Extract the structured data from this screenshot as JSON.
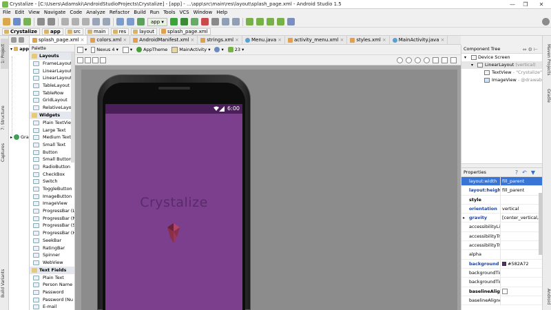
{
  "window": {
    "title": "Crystalize - [C:\\Users\\Adamski\\AndroidStudioProjects\\Crystalize] - [app] - ...\\app\\src\\main\\res\\layout\\splash_page.xml - Android Studio 1.5",
    "minimize": "—",
    "maximize": "❐",
    "close": "✕"
  },
  "menu": [
    "File",
    "Edit",
    "View",
    "Navigate",
    "Code",
    "Analyze",
    "Refactor",
    "Build",
    "Run",
    "Tools",
    "VCS",
    "Window",
    "Help"
  ],
  "toolbar": {
    "run_config": "app ▾"
  },
  "breadcrumbs": [
    "Crystalize",
    "app",
    "src",
    "main",
    "res",
    "layout",
    "splash_page.xml"
  ],
  "left_tabs": {
    "project": "1: Project",
    "structure": "7: Structure",
    "captures": "Captures",
    "build_variants": "Build Variants"
  },
  "project_tree": {
    "root": "app",
    "gradle": "Gra"
  },
  "editor_tabs": [
    {
      "label": "splash_page.xml",
      "color": "#e0a050",
      "active": true
    },
    {
      "label": "colors.xml",
      "color": "#e0a050",
      "active": false
    },
    {
      "label": "AndroidManifest.xml",
      "color": "#e0a050",
      "active": false
    },
    {
      "label": "strings.xml",
      "color": "#e0a050",
      "active": false
    },
    {
      "label": "Menu.java",
      "color": "#5aa0d0",
      "active": false
    },
    {
      "label": "activity_menu.xml",
      "color": "#e0a050",
      "active": false
    },
    {
      "label": "styles.xml",
      "color": "#e0a050",
      "active": false
    },
    {
      "label": "MainActivity.java",
      "color": "#5aa0d0",
      "active": false
    }
  ],
  "palette": {
    "header": "Palette",
    "categories": [
      {
        "name": "Layouts",
        "items": [
          "FrameLayout",
          "LinearLayout (H",
          "LinearLayout (V",
          "TableLayout",
          "TableRow",
          "GridLayout",
          "RelativeLayout"
        ]
      },
      {
        "name": "Widgets",
        "items": [
          "Plain TextView",
          "Large Text",
          "Medium Text",
          "Small Text",
          "Button",
          "Small Button",
          "RadioButton",
          "CheckBox",
          "Switch",
          "ToggleButton",
          "ImageButton",
          "ImageView",
          "ProgressBar (L",
          "ProgressBar (N",
          "ProgressBar (S",
          "ProgressBar (H",
          "SeekBar",
          "RatingBar",
          "Spinner",
          "WebView"
        ]
      },
      {
        "name": "Text Fields",
        "items": [
          "Plain Text",
          "Person Name",
          "Password",
          "Password (Nu",
          "E-mail"
        ]
      }
    ]
  },
  "designer_toolbar": {
    "device": "Nexus 4 ▾",
    "theme": "AppTheme",
    "activity": "MainActivity ▾",
    "api": "23 ▾"
  },
  "device": {
    "status_time": "6:00",
    "app_title": "Crystalize",
    "screen_color": "#7b3f8e",
    "statusbar_color": "#4a1e58"
  },
  "component_tree": {
    "header": "Component Tree",
    "items": [
      {
        "label": "Device Screen",
        "hint": ""
      },
      {
        "label": "LinearLayout",
        "hint": "(vertical)"
      },
      {
        "label": "TextView",
        "hint": "- \"Crystalize\""
      },
      {
        "label": "ImageView",
        "hint": "- @drawable/"
      }
    ]
  },
  "properties": {
    "header": "Properties",
    "rows": [
      {
        "key": "layout:width",
        "value": "fill_parent",
        "style": "sel"
      },
      {
        "key": "layout:height",
        "value": "fill_parent",
        "style": "blue"
      },
      {
        "key": "style",
        "value": "",
        "style": "bold"
      },
      {
        "key": "orientation",
        "value": "vertical",
        "style": "blue"
      },
      {
        "key": "gravity",
        "value": "[center_vertical, c",
        "style": "blue"
      },
      {
        "key": "accessibilityLive",
        "value": "",
        "style": ""
      },
      {
        "key": "accessibilityTra",
        "value": "",
        "style": ""
      },
      {
        "key": "accessibilityTra",
        "value": "",
        "style": ""
      },
      {
        "key": "alpha",
        "value": "",
        "style": ""
      },
      {
        "key": "background",
        "value": "#582A72",
        "style": "blue"
      },
      {
        "key": "backgroundTin",
        "value": "",
        "style": ""
      },
      {
        "key": "backgroundTin",
        "value": "",
        "style": ""
      },
      {
        "key": "baselineAligne",
        "value": "",
        "style": "bold"
      },
      {
        "key": "baselineAligne",
        "value": "",
        "style": ""
      }
    ]
  },
  "right_tabs": {
    "maven": "Maven Projects",
    "gradle": "Gradle",
    "android_model": "Android"
  }
}
